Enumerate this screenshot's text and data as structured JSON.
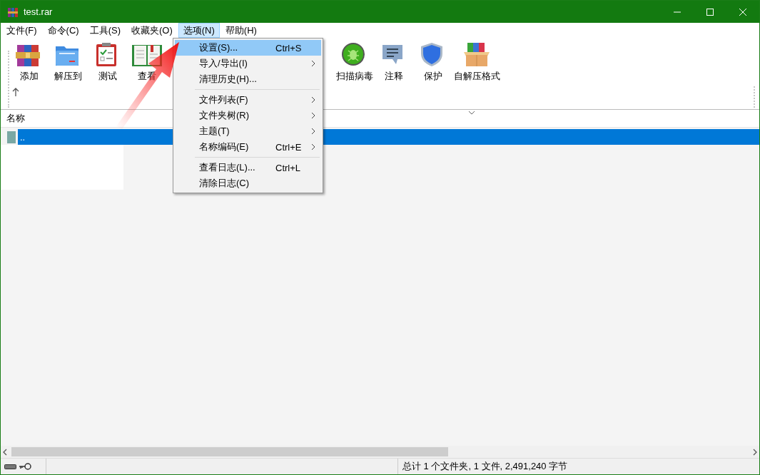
{
  "window": {
    "title": "test.rar"
  },
  "menu_bar": [
    {
      "label": "文件(F)",
      "selected": false
    },
    {
      "label": "命令(C)",
      "selected": false
    },
    {
      "label": "工具(S)",
      "selected": false
    },
    {
      "label": "收藏夹(O)",
      "selected": false
    },
    {
      "label": "选项(N)",
      "selected": true
    },
    {
      "label": "帮助(H)",
      "selected": false
    }
  ],
  "toolbar": {
    "left_buttons": [
      {
        "label": "添加"
      },
      {
        "label": "解压到"
      },
      {
        "label": "测试"
      },
      {
        "label": "查看"
      }
    ],
    "right_buttons": [
      {
        "label": "扫描病毒"
      },
      {
        "label": "注释"
      },
      {
        "label": "保护"
      },
      {
        "label": "自解压格式"
      }
    ]
  },
  "file_list": {
    "columns": [
      {
        "label": "名称"
      }
    ],
    "rows": [
      {
        "name": "..",
        "selected": true
      }
    ]
  },
  "dropdown_menu": [
    {
      "kind": "item",
      "label": "设置(S)...",
      "shortcut": "Ctrl+S",
      "submenu": false,
      "selected": true
    },
    {
      "kind": "item",
      "label": "导入/导出(I)",
      "submenu": true,
      "selected": false
    },
    {
      "kind": "item",
      "label": "清理历史(H)...",
      "submenu": false,
      "selected": false
    },
    {
      "kind": "separator"
    },
    {
      "kind": "item",
      "label": "文件列表(F)",
      "submenu": true,
      "selected": false
    },
    {
      "kind": "item",
      "label": "文件夹树(R)",
      "submenu": true,
      "selected": false
    },
    {
      "kind": "item",
      "label": "主题(T)",
      "submenu": true,
      "selected": false
    },
    {
      "kind": "item",
      "label": "名称编码(E)",
      "shortcut": "Ctrl+E",
      "submenu": true,
      "selected": false
    },
    {
      "kind": "separator"
    },
    {
      "kind": "item",
      "label": "查看日志(L)...",
      "shortcut": "Ctrl+L",
      "submenu": false,
      "selected": false
    },
    {
      "kind": "item",
      "label": "清除日志(C)",
      "submenu": false,
      "selected": false
    }
  ],
  "status_bar": {
    "summary": "总计 1 个文件夹, 1 文件, 2,491,240 字节"
  },
  "annotations": [
    {
      "kind": "arrow"
    }
  ]
}
